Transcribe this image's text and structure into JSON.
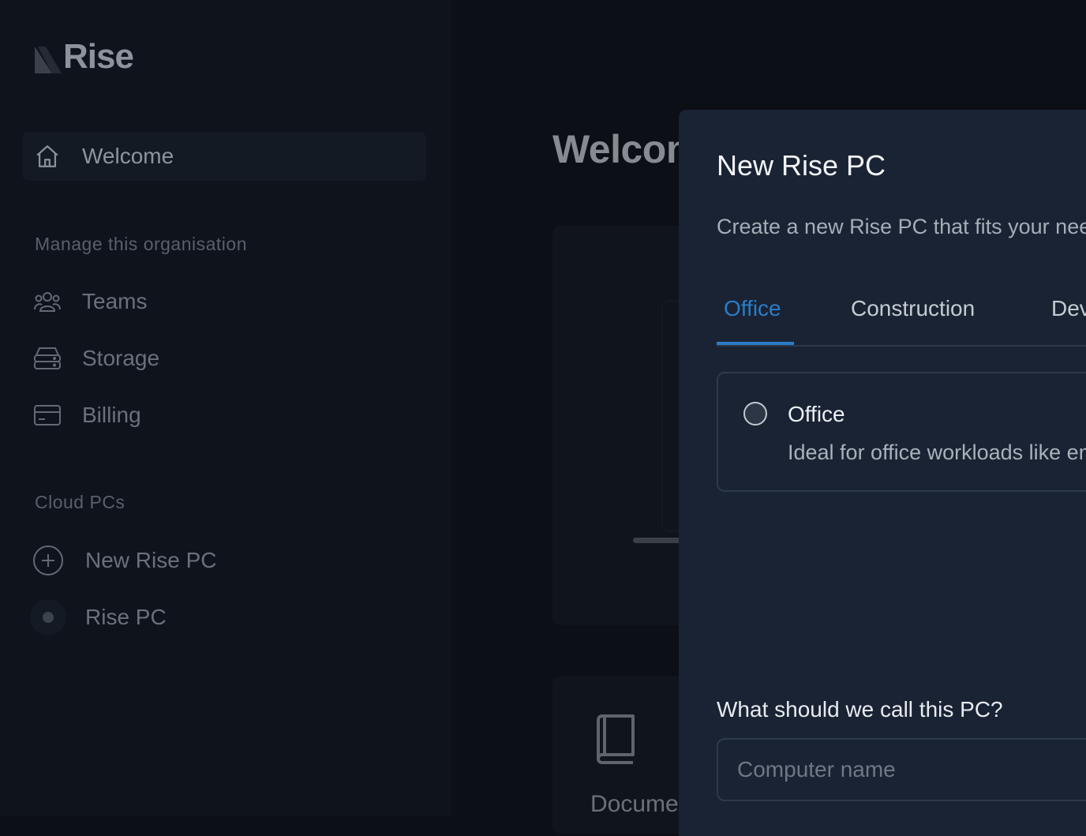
{
  "sidebar": {
    "logo_text": "Rise",
    "welcome_label": "Welcome",
    "manage_section_title": "Manage this organisation",
    "manage_items": [
      {
        "label": "Teams",
        "icon": "users-icon"
      },
      {
        "label": "Storage",
        "icon": "server-icon"
      },
      {
        "label": "Billing",
        "icon": "credit-card-icon"
      }
    ],
    "cloud_section_title": "Cloud PCs",
    "new_pc_label": "New Rise PC",
    "pc_label": "Rise PC"
  },
  "main": {
    "title": "Welcome",
    "doc_card_label": "Documentation"
  },
  "modal": {
    "title": "New Rise PC",
    "subtitle": "Create a new Rise PC that fits your needs",
    "tabs": [
      {
        "label": "Office",
        "active": true
      },
      {
        "label": "Construction",
        "active": false
      },
      {
        "label": "Development",
        "active": false
      }
    ],
    "option": {
      "title": "Office",
      "description": "Ideal for office workloads like email and documents",
      "selected": false
    },
    "name_field_label": "What should we call this PC?",
    "name_field_placeholder": "Computer name",
    "name_field_value": ""
  },
  "colors": {
    "accent": "#2a7cc7",
    "modal_bg": "#1a2333",
    "sidebar_bg": "#0e131c"
  }
}
